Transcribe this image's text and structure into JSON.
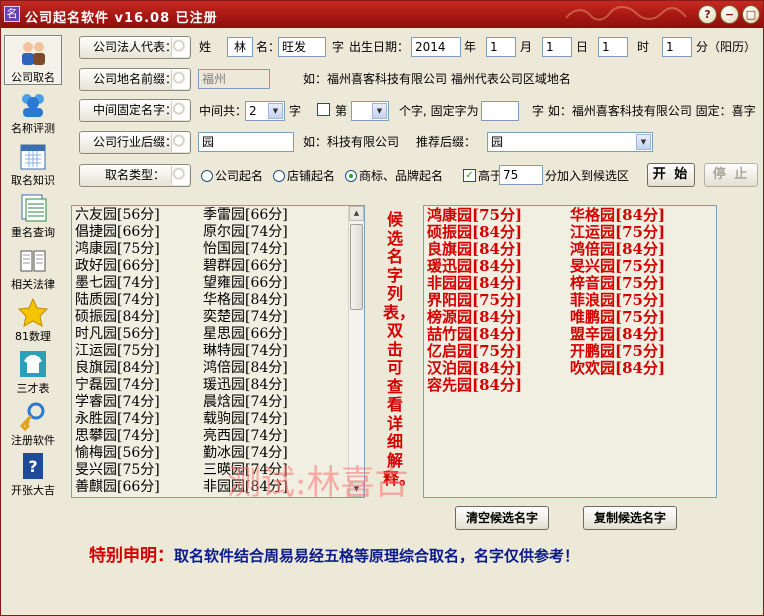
{
  "window": {
    "title": "公司起名软件 v16.08  已注册"
  },
  "titlebar_buttons": [
    "help",
    "minimize",
    "maximize",
    "close"
  ],
  "sidebar": {
    "items": [
      {
        "label": "公司取名",
        "icon": "people-icon",
        "selected": true
      },
      {
        "label": "名称评测",
        "icon": "group-icon"
      },
      {
        "label": "取名知识",
        "icon": "calendar-icon"
      },
      {
        "label": "重名查询",
        "icon": "table-icon"
      },
      {
        "label": "相关法律",
        "icon": "book-icon"
      },
      {
        "label": "81数理",
        "icon": "star-icon"
      },
      {
        "label": "三才表",
        "icon": "shirt-icon"
      },
      {
        "label": "注册软件",
        "icon": "key-icon"
      },
      {
        "label": "开张大吉",
        "icon": "help-book-icon"
      }
    ]
  },
  "row1": {
    "button": "公司法人代表：",
    "surname_label": "姓",
    "surname": "林",
    "name_label": "名：",
    "given_name": "旺发",
    "char_label": "字",
    "birth_label": "出生日期：",
    "year": "2014",
    "year_label": "年",
    "month": "1",
    "month_label": "月",
    "day": "1",
    "day_label": "日",
    "hour": "1",
    "hour_label": "时",
    "minute": "1",
    "minute_label": "分（阳历）"
  },
  "row2": {
    "button": "公司地名前缀：",
    "value": "福州",
    "example": "如：福州喜客科技有限公司 福州代表公司区域地名"
  },
  "row3": {
    "button": "中间固定名字：",
    "total_label": "中间共：",
    "total_value": "2",
    "char_label": "字",
    "nth_label": "第",
    "nth_value": "",
    "fixed_label": "个字, 固定字为",
    "fixed_value": "",
    "tail": "字  如：福州喜客科技有限公司  固定：喜字"
  },
  "row4": {
    "button": "公司行业后缀：",
    "value": "园",
    "example": "如：科技有限公司",
    "recommend_label": "推荐后缀：",
    "recommend_value": "园"
  },
  "row5": {
    "button": "取名类型：",
    "options": [
      "公司起名",
      "店铺起名",
      "商标、品牌起名"
    ],
    "selected_option": 2,
    "higher_label": "高于",
    "higher_checked": true,
    "threshold": "75",
    "threshold_tail": "分加入到候选区",
    "start_button": "开  始",
    "stop_button": "停  止"
  },
  "name_list": {
    "col1": [
      "六友园[56分]",
      "倡捷园[66分]",
      "鸿康园[75分]",
      "政好园[66分]",
      "墨七园[74分]",
      "陆质园[74分]",
      "硕振园[84分]",
      "时凡园[56分]",
      "江运园[75分]",
      "良旗园[84分]",
      "宁磊园[74分]",
      "学睿园[74分]",
      "永胜园[74分]",
      "思攀园[74分]",
      "愉梅园[56分]",
      "旻兴园[75分]",
      "善麒园[66分]"
    ],
    "col2": [
      "季雷园[66分]",
      "原尔园[74分]",
      "怡国园[74分]",
      "碧群园[66分]",
      "望雍园[66分]",
      "华格园[84分]",
      "奕楚园[74分]",
      "星思园[66分]",
      "琳特园[74分]",
      "鸿倍园[84分]",
      "瑗迅园[84分]",
      "晨焓园[74分]",
      "载驹园[74分]",
      "亮西园[74分]",
      "勤冰园[74分]",
      "三暎园[74分]",
      "非园园[84分]"
    ]
  },
  "vertical_note": "候选名字列表，双击可查看详细解释。",
  "candidates": {
    "col1": [
      "鸿康园[75分]",
      "硕振园[84分]",
      "良旗园[84分]",
      "瑗迅园[84分]",
      "非园园[84分]",
      "界阳园[75分]",
      "榜源园[84分]",
      "喆竹园[84分]",
      "亿启园[75分]",
      "汉泊园[84分]",
      "容先园[84分]"
    ],
    "col2": [
      "华格园[84分]",
      "江运园[75分]",
      "鸿倍园[84分]",
      "旻兴园[75分]",
      "梓音园[75分]",
      "菲浪园[75分]",
      "唯鹏园[75分]",
      "盟辛园[84分]",
      "开鹏园[75分]",
      "吹欢园[84分]"
    ]
  },
  "clear_button": "清空候选名字",
  "copy_button": "复制候选名字",
  "watermark": "测试:林喜古",
  "notice": {
    "lead": "特别申明：",
    "body": "取名软件结合周易易经五格等原理综合取名，名字仅供参考！"
  }
}
